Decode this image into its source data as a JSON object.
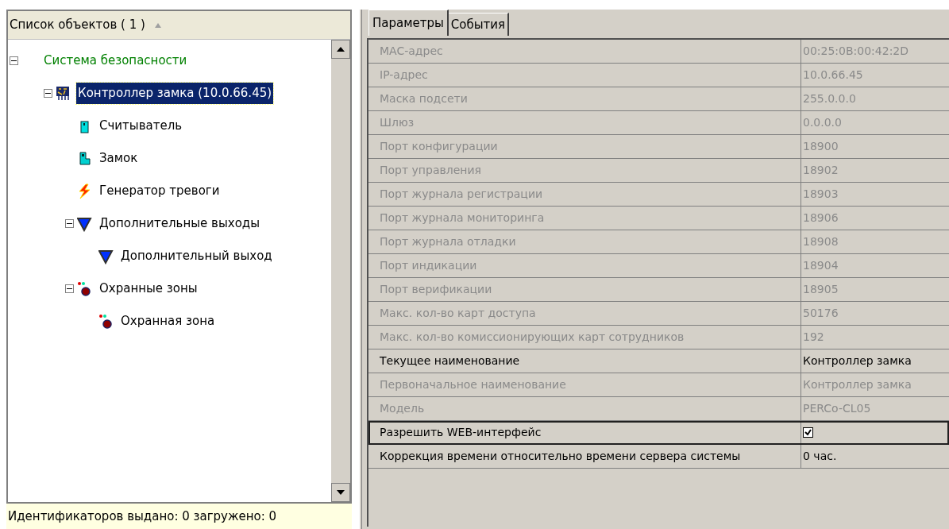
{
  "object_list": {
    "header": "Список объектов ( 1 )",
    "sort_ascending": true,
    "tree": [
      {
        "label": "Система безопасности",
        "kind": "root",
        "expanded": true,
        "selected": false,
        "children": [
          {
            "label": "Контроллер замка (10.0.66.45)",
            "kind": "controller",
            "expanded": true,
            "selected": true,
            "children": [
              {
                "label": "Считыватель",
                "kind": "reader",
                "selected": false
              },
              {
                "label": "Замок",
                "kind": "lock",
                "selected": false
              },
              {
                "label": "Генератор тревоги",
                "kind": "alarm",
                "selected": false
              },
              {
                "label": "Дополнительные выходы",
                "kind": "output",
                "expanded": true,
                "selected": false,
                "children": [
                  {
                    "label": "Дополнительный выход",
                    "kind": "output",
                    "selected": false
                  }
                ]
              },
              {
                "label": "Охранные зоны",
                "kind": "zone",
                "expanded": true,
                "selected": false,
                "children": [
                  {
                    "label": "Охранная зона",
                    "kind": "zone",
                    "selected": false
                  }
                ]
              }
            ]
          }
        ]
      }
    ]
  },
  "status_bar": "Идентификаторов выдано: 0 загружено: 0",
  "tabs": [
    {
      "label": "Параметры",
      "selected": true
    },
    {
      "label": "События",
      "selected": false
    }
  ],
  "properties": [
    {
      "name": "MAC-адрес",
      "value": "00:25:0B:00:42:2D",
      "kind": "text",
      "disabled": true,
      "selected": false
    },
    {
      "name": "IP-адрес",
      "value": "10.0.66.45",
      "kind": "text",
      "disabled": true,
      "selected": false
    },
    {
      "name": "Маска подсети",
      "value": "255.0.0.0",
      "kind": "text",
      "disabled": true,
      "selected": false
    },
    {
      "name": "Шлюз",
      "value": "0.0.0.0",
      "kind": "text",
      "disabled": true,
      "selected": false
    },
    {
      "name": "Порт конфигурации",
      "value": "18900",
      "kind": "text",
      "disabled": true,
      "selected": false
    },
    {
      "name": "Порт управления",
      "value": "18902",
      "kind": "text",
      "disabled": true,
      "selected": false
    },
    {
      "name": "Порт журнала регистрации",
      "value": "18903",
      "kind": "text",
      "disabled": true,
      "selected": false
    },
    {
      "name": "Порт журнала мониторинга",
      "value": "18906",
      "kind": "text",
      "disabled": true,
      "selected": false
    },
    {
      "name": "Порт журнала отладки",
      "value": "18908",
      "kind": "text",
      "disabled": true,
      "selected": false
    },
    {
      "name": "Порт индикации",
      "value": "18904",
      "kind": "text",
      "disabled": true,
      "selected": false
    },
    {
      "name": "Порт верификации",
      "value": "18905",
      "kind": "text",
      "disabled": true,
      "selected": false
    },
    {
      "name": "Макс. кол-во карт доступа",
      "value": "50176",
      "kind": "text",
      "disabled": true,
      "selected": false
    },
    {
      "name": "Макс. кол-во комиссионирующих карт сотрудников",
      "value": "192",
      "kind": "text",
      "disabled": true,
      "selected": false
    },
    {
      "name": "Текущее наименование",
      "value": "Контроллер замка",
      "kind": "text",
      "disabled": false,
      "selected": false
    },
    {
      "name": "Первоначальное наименование",
      "value": "Контроллер замка",
      "kind": "text",
      "disabled": true,
      "selected": false
    },
    {
      "name": "Модель",
      "value": "PERCo-CL05",
      "kind": "text",
      "disabled": true,
      "selected": false
    },
    {
      "name": "Разрешить WEB-интерфейс",
      "checked": true,
      "kind": "checkbox",
      "disabled": false,
      "selected": true
    },
    {
      "name": "Коррекция времени относительно времени сервера системы",
      "value": "0 час.",
      "kind": "text",
      "disabled": false,
      "selected": false
    }
  ]
}
